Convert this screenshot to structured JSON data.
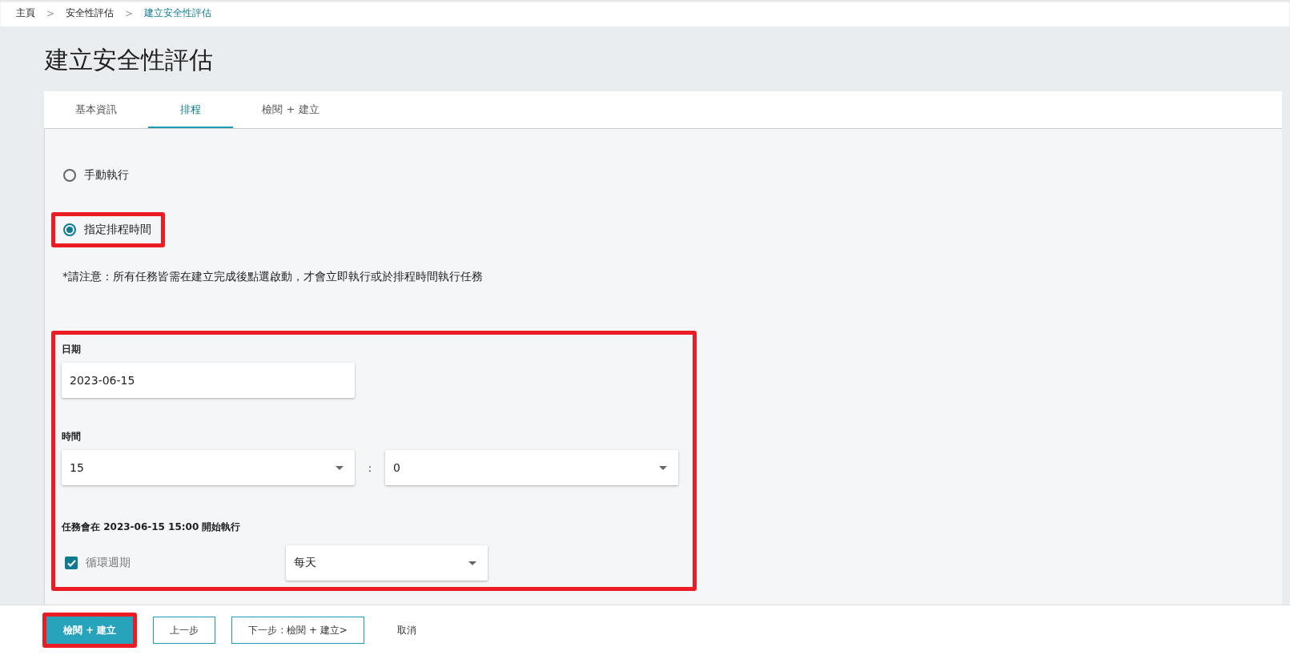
{
  "breadcrumb": [
    {
      "label": "主頁",
      "current": false
    },
    {
      "label": "安全性評估",
      "current": false
    },
    {
      "label": "建立安全性評估",
      "current": true
    }
  ],
  "breadcrumb_separator": ">",
  "page_title": "建立安全性評估",
  "tabs": [
    {
      "label": "基本資訊",
      "selected": false
    },
    {
      "label": "排程",
      "selected": true
    },
    {
      "label": "檢閱 + 建立",
      "selected": false
    }
  ],
  "run_options": [
    {
      "label": "手動執行",
      "selected": false,
      "highlighted": false
    },
    {
      "label": "指定排程時間",
      "selected": true,
      "highlighted": true
    }
  ],
  "note": "*請注意：所有任務皆需在建立完成後點選啟動，才會立即執行或於排程時間執行任務",
  "schedule": {
    "highlighted": true,
    "date_label": "日期",
    "date_value": "2023-06-15",
    "time_label": "時間",
    "hour": "15",
    "time_separator": ":",
    "minute": "0",
    "summary": "任務會在 2023-06-15 15:00 開始執行",
    "repeat": {
      "label": "循環週期",
      "checked": true
    },
    "frequency": "每天"
  },
  "footer_buttons": [
    {
      "label": "檢閱 + 建立",
      "kind": "primary",
      "highlighted": true
    },
    {
      "label": "上一步",
      "kind": "outline",
      "highlighted": false
    },
    {
      "label": "下一步 : 檢閱 + 建立>",
      "kind": "outline",
      "highlighted": false
    },
    {
      "label": "取消",
      "kind": "text",
      "highlighted": false
    }
  ]
}
